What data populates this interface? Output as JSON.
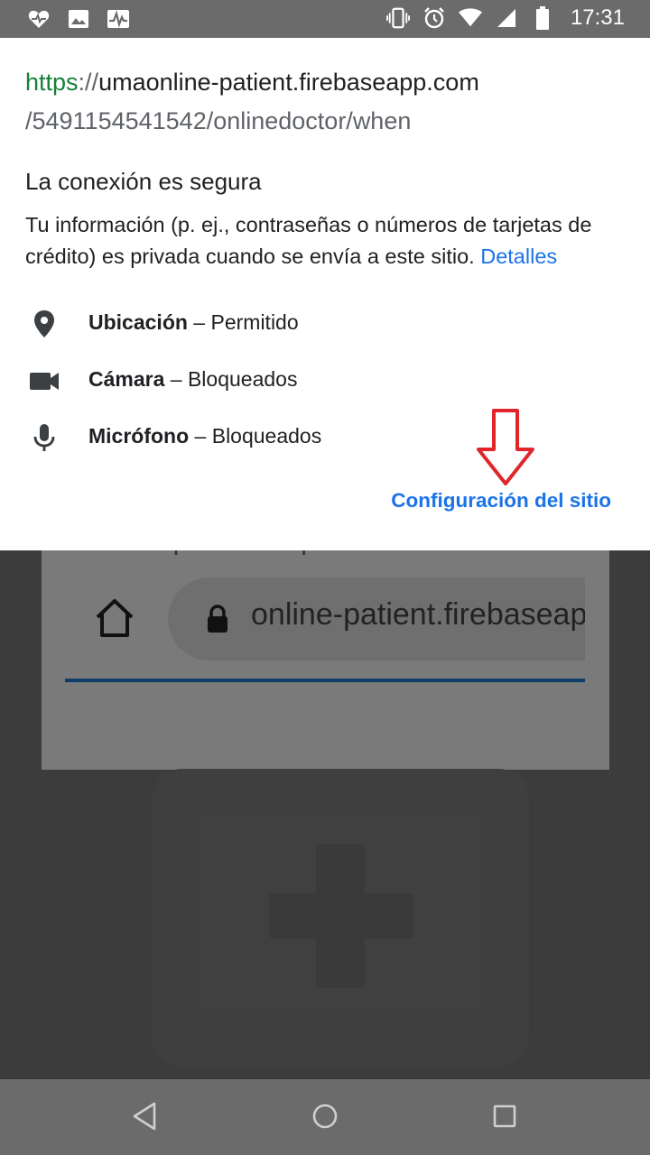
{
  "status_bar": {
    "left_icons": [
      "heart-monitor-icon",
      "image-icon",
      "activity-icon"
    ],
    "right_icons": [
      "vibrate-icon",
      "alarm-icon",
      "wifi-icon",
      "signal-icon",
      "battery-icon"
    ],
    "time": "17:31"
  },
  "popup": {
    "url_scheme": "https",
    "url_separator": "://",
    "url_host": "umaonline-patient.firebaseapp.com",
    "url_path": "/5491154541542/onlinedoctor/when",
    "connection_title": "La conexión es segura",
    "connection_description": "Tu información (p. ej., contraseñas o números de tarjetas de crédito) es privada cuando se envía a este sitio. ",
    "details_link": "Detalles",
    "permissions": [
      {
        "name": "Ubicación",
        "status": "Permitido",
        "icon": "location-pin-icon"
      },
      {
        "name": "Cámara",
        "status": "Bloqueados",
        "icon": "camera-icon"
      },
      {
        "name": "Micrófono",
        "status": "Bloqueados",
        "icon": "microphone-icon"
      }
    ],
    "permission_separator": " – ",
    "site_settings_link": "Configuración del sitio",
    "annotation_color": "#e0262b",
    "accent_color": "#1a73e8",
    "https_color": "#188038"
  },
  "background_page": {
    "partial_text": "dirección para editar permisos.",
    "url_text": "online-patient.firebaseapp.com"
  },
  "nav_bar": {
    "buttons": [
      "back-icon",
      "home-icon",
      "recents-icon"
    ]
  }
}
